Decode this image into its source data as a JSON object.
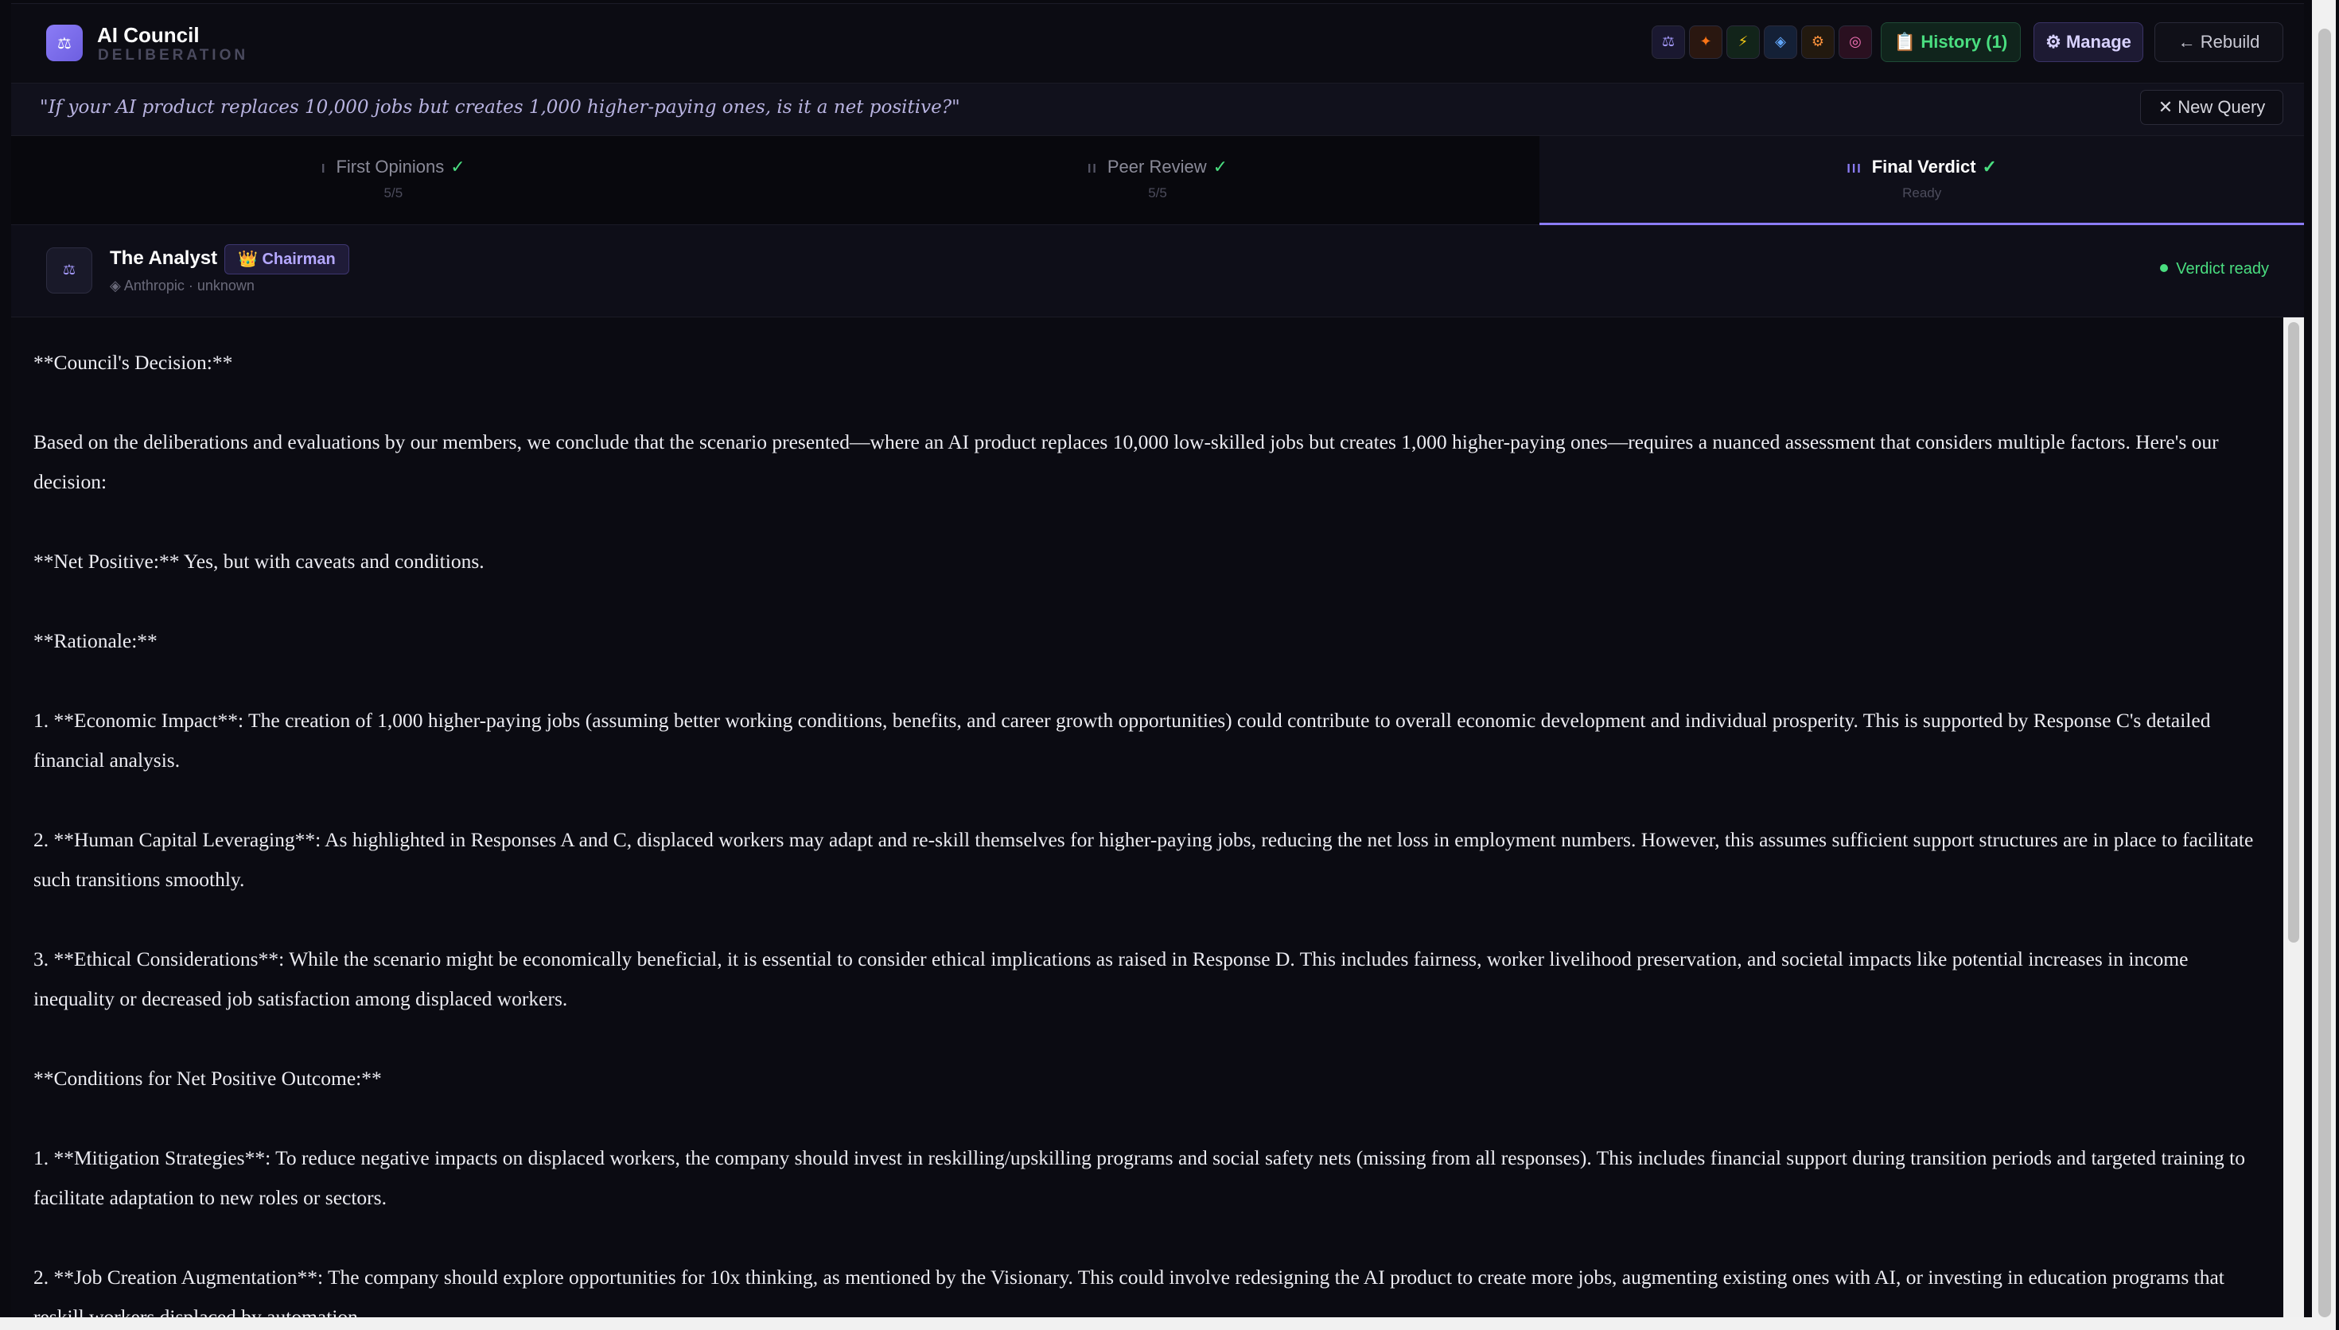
{
  "header": {
    "logo_glyph": "⚖",
    "title": "AI Council",
    "subtitle": "DELIBERATION",
    "member_icons": [
      {
        "name": "scales-icon",
        "glyph": "⚖",
        "color": "#a79cff",
        "bg": "#1a1830"
      },
      {
        "name": "sparkle-icon",
        "glyph": "✦",
        "color": "#f97316",
        "bg": "#2a1710"
      },
      {
        "name": "bolt-icon",
        "glyph": "⚡",
        "color": "#facc15",
        "bg": "#12241a"
      },
      {
        "name": "diamond-icon",
        "glyph": "◈",
        "color": "#60a5fa",
        "bg": "#142036"
      },
      {
        "name": "gear-icon",
        "glyph": "⚙",
        "color": "#fb923c",
        "bg": "#22190f"
      },
      {
        "name": "target-icon",
        "glyph": "◎",
        "color": "#f472b6",
        "bg": "#2a1020"
      }
    ],
    "history_label": "📋 History (1)",
    "manage_label": "⚙ Manage",
    "rebuild_label": "← Rebuild"
  },
  "query": {
    "text": "\"If your AI product replaces 10,000 jobs but creates 1,000 higher-paying ones, is it a net positive?\"",
    "new_query_label": "✕ New Query"
  },
  "tabs": [
    {
      "num": "I",
      "label": "First Opinions",
      "check": "✓",
      "sub": "5/5",
      "active": false
    },
    {
      "num": "II",
      "label": "Peer Review",
      "check": "✓",
      "sub": "5/5",
      "active": false
    },
    {
      "num": "III",
      "label": "Final Verdict",
      "check": "✓",
      "sub": "Ready",
      "active": true
    }
  ],
  "agent": {
    "avatar_glyph": "⚖",
    "name": "The Analyst",
    "badge": "👑 Chairman",
    "meta": "◈ Anthropic · unknown",
    "status": "Verdict ready"
  },
  "verdict": {
    "paragraphs": [
      "**Council's Decision:**",
      "Based on the deliberations and evaluations by our members, we conclude that the scenario presented—where an AI product replaces 10,000 low-skilled jobs but creates 1,000 higher-paying ones—requires a nuanced assessment that considers multiple factors. Here's our decision:",
      "**Net Positive:** Yes, but with caveats and conditions.",
      "**Rationale:**",
      "1. **Economic Impact**: The creation of 1,000 higher-paying jobs (assuming better working conditions, benefits, and career growth opportunities) could contribute to overall economic development and individual prosperity. This is supported by Response C's detailed financial analysis.",
      "2. **Human Capital Leveraging**: As highlighted in Responses A and C, displaced workers may adapt and re-skill themselves for higher-paying jobs, reducing the net loss in employment numbers. However, this assumes sufficient support structures are in place to facilitate such transitions smoothly.",
      "3. **Ethical Considerations**: While the scenario might be economically beneficial, it is essential to consider ethical implications as raised in Response D. This includes fairness, worker livelihood preservation, and societal impacts like potential increases in income inequality or decreased job satisfaction among displaced workers.",
      "**Conditions for Net Positive Outcome:**",
      "1. **Mitigation Strategies**: To reduce negative impacts on displaced workers, the company should invest in reskilling/upskilling programs and social safety nets (missing from all responses). This includes financial support during transition periods and targeted training to facilitate adaptation to new roles or sectors.",
      "2. **Job Creation Augmentation**: The company should explore opportunities for 10x thinking, as mentioned by the Visionary. This could involve redesigning the AI product to create more jobs, augmenting existing ones with AI, or investing in education programs that reskill workers displaced by automation."
    ]
  }
}
